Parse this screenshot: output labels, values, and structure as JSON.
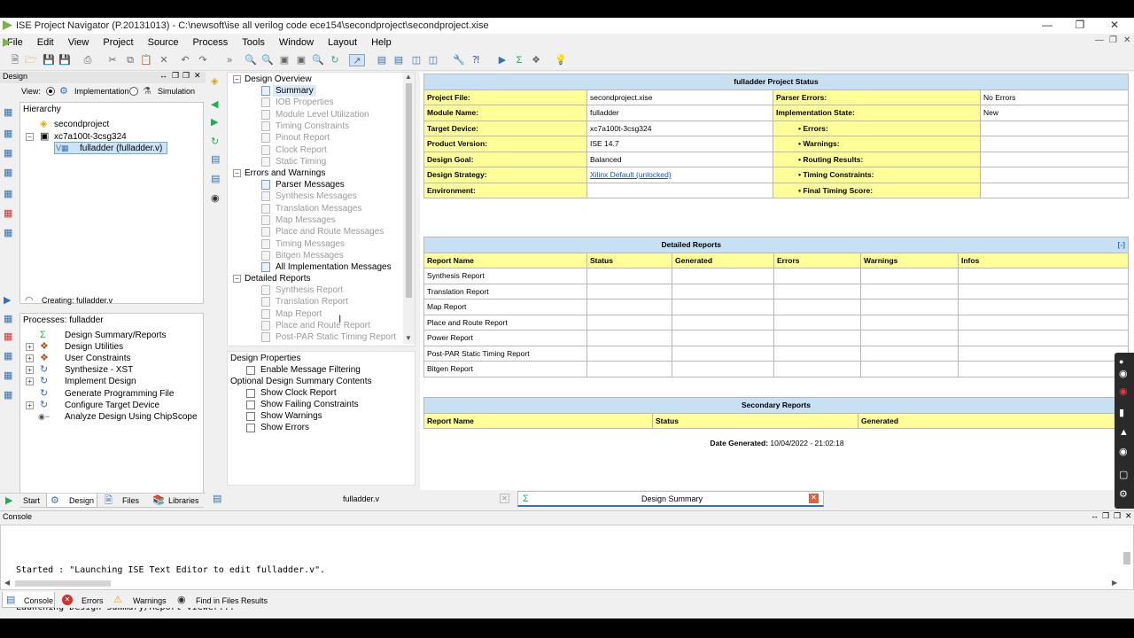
{
  "window": {
    "title": "ISE Project Navigator (P.20131013) - C:\\newsoft\\ise all verilog code ece154\\secondproject\\secondproject.xise"
  },
  "menu": [
    "File",
    "Edit",
    "View",
    "Project",
    "Source",
    "Process",
    "Tools",
    "Window",
    "Layout",
    "Help"
  ],
  "design_panel": {
    "title": "Design",
    "view_label": "View:",
    "implementation_label": "Implementation",
    "simulation_label": "Simulation",
    "hierarchy_label": "Hierarchy",
    "items": [
      "secondproject",
      "xc7a100t-3csg324",
      "fulladder (fulladder.v)"
    ],
    "creating_label": "Creating: fulladder.v",
    "processes_label": "Processes: fulladder",
    "processes": [
      "Design Summary/Reports",
      "Design Utilities",
      "User Constraints",
      "Synthesize - XST",
      "Implement Design",
      "Generate Programming File",
      "Configure Target Device",
      "Analyze Design Using ChipScope"
    ]
  },
  "summary_tree": {
    "design_overview": "Design Overview",
    "overview_items": [
      {
        "label": "Summary",
        "enabled": true
      },
      {
        "label": "IOB Properties",
        "enabled": false
      },
      {
        "label": "Module Level Utilization",
        "enabled": false
      },
      {
        "label": "Timing Constraints",
        "enabled": false
      },
      {
        "label": "Pinout Report",
        "enabled": false
      },
      {
        "label": "Clock Report",
        "enabled": false
      },
      {
        "label": "Static Timing",
        "enabled": false
      }
    ],
    "errors_warnings": "Errors and Warnings",
    "ew_items": [
      {
        "label": "Parser Messages",
        "enabled": true
      },
      {
        "label": "Synthesis Messages",
        "enabled": false
      },
      {
        "label": "Translation Messages",
        "enabled": false
      },
      {
        "label": "Map Messages",
        "enabled": false
      },
      {
        "label": "Place and Route Messages",
        "enabled": false
      },
      {
        "label": "Timing Messages",
        "enabled": false
      },
      {
        "label": "Bitgen Messages",
        "enabled": false
      },
      {
        "label": "All Implementation Messages",
        "enabled": true
      }
    ],
    "detailed_reports": "Detailed Reports",
    "dr_items": [
      {
        "label": "Synthesis Report",
        "enabled": false
      },
      {
        "label": "Translation Report",
        "enabled": false
      },
      {
        "label": "Map Report",
        "enabled": false
      },
      {
        "label": "Place and Route Report",
        "enabled": false
      },
      {
        "label": "Post-PAR Static Timing Report",
        "enabled": false
      }
    ]
  },
  "design_properties": {
    "title": "Design Properties",
    "enable_filtering": "Enable Message Filtering",
    "optional_title": "Optional Design Summary Contents",
    "options": [
      "Show Clock Report",
      "Show Failing Constraints",
      "Show Warnings",
      "Show Errors"
    ]
  },
  "project_status": {
    "title": "fulladder Project Status",
    "rows": [
      {
        "k1": "Project File:",
        "v1": "secondproject.xise",
        "k2": "Parser Errors:",
        "v2": "No Errors"
      },
      {
        "k1": "Module Name:",
        "v1": "fulladder",
        "k2": "Implementation State:",
        "v2": "New"
      },
      {
        "k1": "Target Device:",
        "v1": "xc7a100t-3csg324",
        "k2": "• Errors:",
        "v2": ""
      },
      {
        "k1": "Product Version:",
        "v1": "ISE 14.7",
        "k2": "• Warnings:",
        "v2": ""
      },
      {
        "k1": "Design Goal:",
        "v1": "Balanced",
        "k2": "• Routing Results:",
        "v2": ""
      },
      {
        "k1": "Design Strategy:",
        "v1": "Xilinx Default (unlocked)",
        "k2": "• Timing Constraints:",
        "v2": ""
      },
      {
        "k1": "Environment:",
        "v1": "",
        "k2": "• Final Timing Score:",
        "v2": ""
      }
    ]
  },
  "detailed_reports": {
    "title": "Detailed Reports",
    "collapse": "[-]",
    "headers": [
      "Report Name",
      "Status",
      "Generated",
      "Errors",
      "Warnings",
      "Infos"
    ],
    "rows": [
      "Synthesis Report",
      "Translation Report",
      "Map Report",
      "Place and Route Report",
      "Power Report",
      "Post-PAR Static Timing Report",
      "Bitgen Report"
    ]
  },
  "secondary_reports": {
    "title": "Secondary Reports",
    "headers": [
      "Report Name",
      "Status",
      "Generated"
    ]
  },
  "date_generated": {
    "label": "Date Generated:",
    "value": "10/04/2022 - 21:02:18"
  },
  "left_tabs": [
    "Start",
    "Design",
    "Files",
    "Libraries"
  ],
  "doc_tabs": [
    "fulladder.v",
    "Design Summary"
  ],
  "console": {
    "title": "Console",
    "lines": [
      "Started : \"Launching ISE Text Editor to edit fulladder.v\".",
      "Launching Design Summary/Report Viewer..."
    ],
    "tabs": [
      "Console",
      "Errors",
      "Warnings",
      "Find in Files Results"
    ]
  }
}
